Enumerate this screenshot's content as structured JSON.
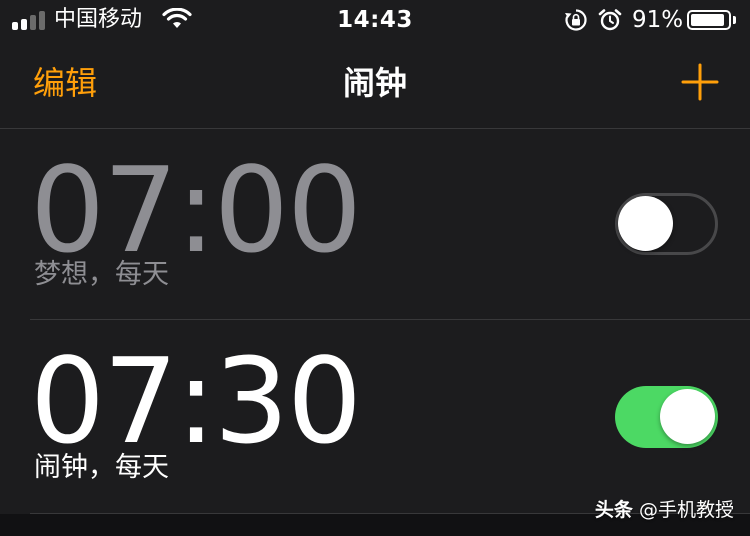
{
  "status_bar": {
    "carrier": "中国移动",
    "time": "14:43",
    "battery_percent": "91%",
    "battery_level": 0.91,
    "signal_strength_bars": 2,
    "signal_total_bars": 4,
    "icons": [
      "signal-icon",
      "wifi-icon",
      "orientation-lock-icon",
      "alarm-icon",
      "battery-icon"
    ]
  },
  "nav": {
    "edit_label": "编辑",
    "title": "闹钟",
    "add_icon": "plus-icon"
  },
  "alarms": [
    {
      "time": "07:00",
      "label": "梦想，每天",
      "enabled": false
    },
    {
      "time": "07:30",
      "label": "闹钟，每天",
      "enabled": true
    }
  ],
  "watermark": {
    "source": "头条",
    "handle": "@手机教授"
  },
  "colors": {
    "accent": "#ff9f0a",
    "toggle_on": "#4cd964",
    "toggle_off_border": "#48484a",
    "background": "#1c1c1e",
    "disabled_text": "#8e8e93"
  }
}
